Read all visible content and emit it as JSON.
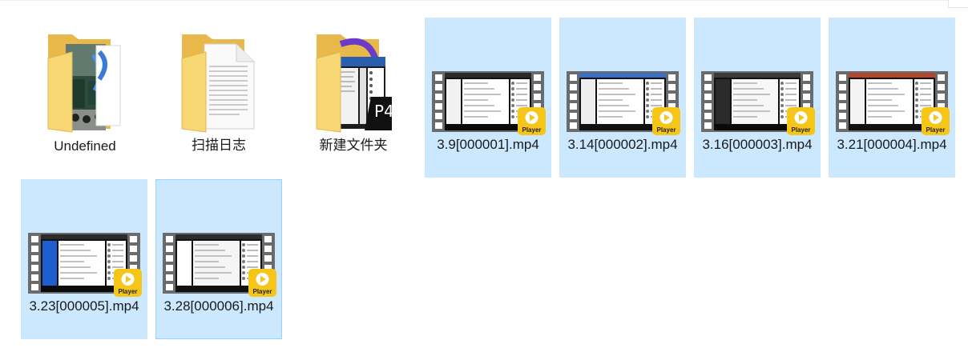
{
  "folders": [
    {
      "name": "Undefined",
      "icon": "folder-with-photo-preview-icon"
    },
    {
      "name": "扫描日志",
      "icon": "folder-with-document-preview-icon"
    },
    {
      "name": "新建文件夹",
      "icon": "folder-with-mp4-preview-icon"
    }
  ],
  "videos": [
    {
      "name": "3.9[000001].mp4",
      "badge": "Player"
    },
    {
      "name": "3.14[000002].mp4",
      "badge": "Player"
    },
    {
      "name": "3.16[000003].mp4",
      "badge": "Player"
    },
    {
      "name": "3.21[000004].mp4",
      "badge": "Player"
    },
    {
      "name": "3.23[000005].mp4",
      "badge": "Player"
    },
    {
      "name": "3.28[000006].mp4",
      "badge": "Player"
    }
  ],
  "folder_preview": {
    "mp4_tag": "P4"
  },
  "colors": {
    "selection_bg": "#cce8ff",
    "selection_border": "#99d1ff",
    "folder_yellow": "#f8d775",
    "folder_dark": "#e8b84a",
    "player_badge": "#f5c518"
  }
}
